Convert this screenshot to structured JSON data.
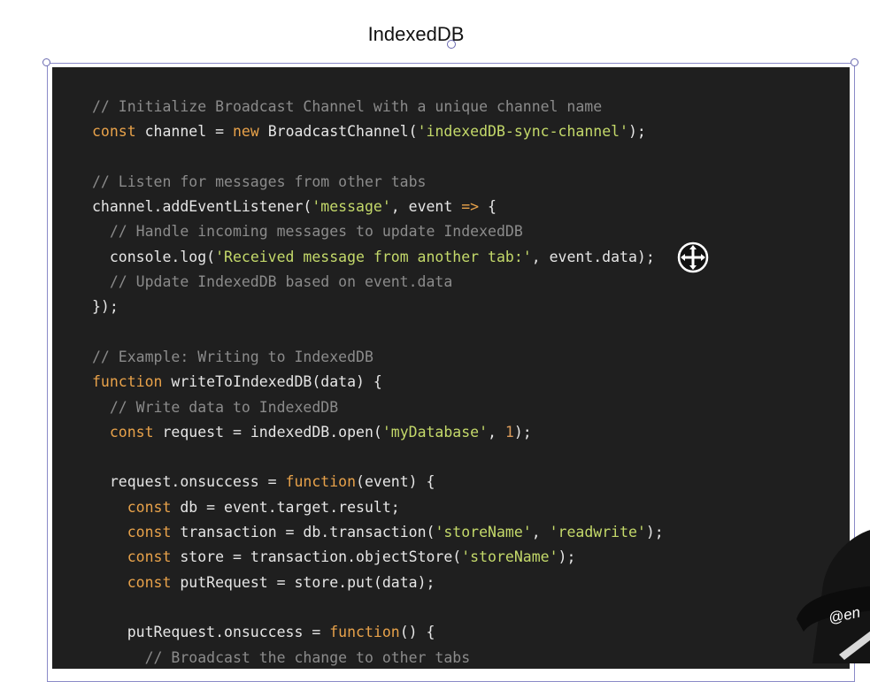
{
  "window": {
    "title": "IndexedDB"
  },
  "code_lines": [
    [
      {
        "t": "// Initialize Broadcast Channel with a unique channel name",
        "c": "cm"
      }
    ],
    [
      {
        "t": "const",
        "c": "kw"
      },
      {
        "t": " channel = ",
        "c": "pl"
      },
      {
        "t": "new",
        "c": "kw"
      },
      {
        "t": " BroadcastChannel(",
        "c": "pl"
      },
      {
        "t": "'indexedDB-sync-channel'",
        "c": "st"
      },
      {
        "t": ");",
        "c": "pl"
      }
    ],
    [],
    [
      {
        "t": "// Listen for messages from other tabs",
        "c": "cm"
      }
    ],
    [
      {
        "t": "channel.addEventListener(",
        "c": "pl"
      },
      {
        "t": "'message'",
        "c": "st"
      },
      {
        "t": ", event ",
        "c": "pl"
      },
      {
        "t": "=>",
        "c": "kw"
      },
      {
        "t": " {",
        "c": "pl"
      }
    ],
    [
      {
        "t": "  // Handle incoming messages to update IndexedDB",
        "c": "cm"
      }
    ],
    [
      {
        "t": "  console.log(",
        "c": "pl"
      },
      {
        "t": "'Received message from another tab:'",
        "c": "st"
      },
      {
        "t": ", event.data);",
        "c": "pl"
      }
    ],
    [
      {
        "t": "  // Update IndexedDB based on event.data",
        "c": "cm"
      }
    ],
    [
      {
        "t": "});",
        "c": "pl"
      }
    ],
    [],
    [
      {
        "t": "// Example: Writing to IndexedDB",
        "c": "cm"
      }
    ],
    [
      {
        "t": "function",
        "c": "kw"
      },
      {
        "t": " writeToIndexedDB(data) {",
        "c": "pl"
      }
    ],
    [
      {
        "t": "  // Write data to IndexedDB",
        "c": "cm"
      }
    ],
    [
      {
        "t": "  ",
        "c": "pl"
      },
      {
        "t": "const",
        "c": "kw"
      },
      {
        "t": " request = indexedDB.open(",
        "c": "pl"
      },
      {
        "t": "'myDatabase'",
        "c": "st"
      },
      {
        "t": ", ",
        "c": "pl"
      },
      {
        "t": "1",
        "c": "nm"
      },
      {
        "t": ");",
        "c": "pl"
      }
    ],
    [],
    [
      {
        "t": "  request.onsuccess = ",
        "c": "pl"
      },
      {
        "t": "function",
        "c": "kw"
      },
      {
        "t": "(event) {",
        "c": "pl"
      }
    ],
    [
      {
        "t": "    ",
        "c": "pl"
      },
      {
        "t": "const",
        "c": "kw"
      },
      {
        "t": " db = event.target.result;",
        "c": "pl"
      }
    ],
    [
      {
        "t": "    ",
        "c": "pl"
      },
      {
        "t": "const",
        "c": "kw"
      },
      {
        "t": " transaction = db.transaction(",
        "c": "pl"
      },
      {
        "t": "'storeName'",
        "c": "st"
      },
      {
        "t": ", ",
        "c": "pl"
      },
      {
        "t": "'readwrite'",
        "c": "st"
      },
      {
        "t": ");",
        "c": "pl"
      }
    ],
    [
      {
        "t": "    ",
        "c": "pl"
      },
      {
        "t": "const",
        "c": "kw"
      },
      {
        "t": " store = transaction.objectStore(",
        "c": "pl"
      },
      {
        "t": "'storeName'",
        "c": "st"
      },
      {
        "t": ");",
        "c": "pl"
      }
    ],
    [
      {
        "t": "    ",
        "c": "pl"
      },
      {
        "t": "const",
        "c": "kw"
      },
      {
        "t": " putRequest = store.put(data);",
        "c": "pl"
      }
    ],
    [],
    [
      {
        "t": "    putRequest.onsuccess = ",
        "c": "pl"
      },
      {
        "t": "function",
        "c": "kw"
      },
      {
        "t": "() {",
        "c": "pl"
      }
    ],
    [
      {
        "t": "      // Broadcast the change to other tabs",
        "c": "cm"
      }
    ]
  ],
  "watermark": {
    "text": "@en"
  },
  "icons": {
    "cursor": "move-cursor-icon"
  },
  "colors": {
    "background": "#1f1f1f",
    "comment": "#8b8b8b",
    "keyword": "#e8a24a",
    "string": "#c4d96a",
    "number": "#d99a5a",
    "text": "#e6e6e6"
  }
}
